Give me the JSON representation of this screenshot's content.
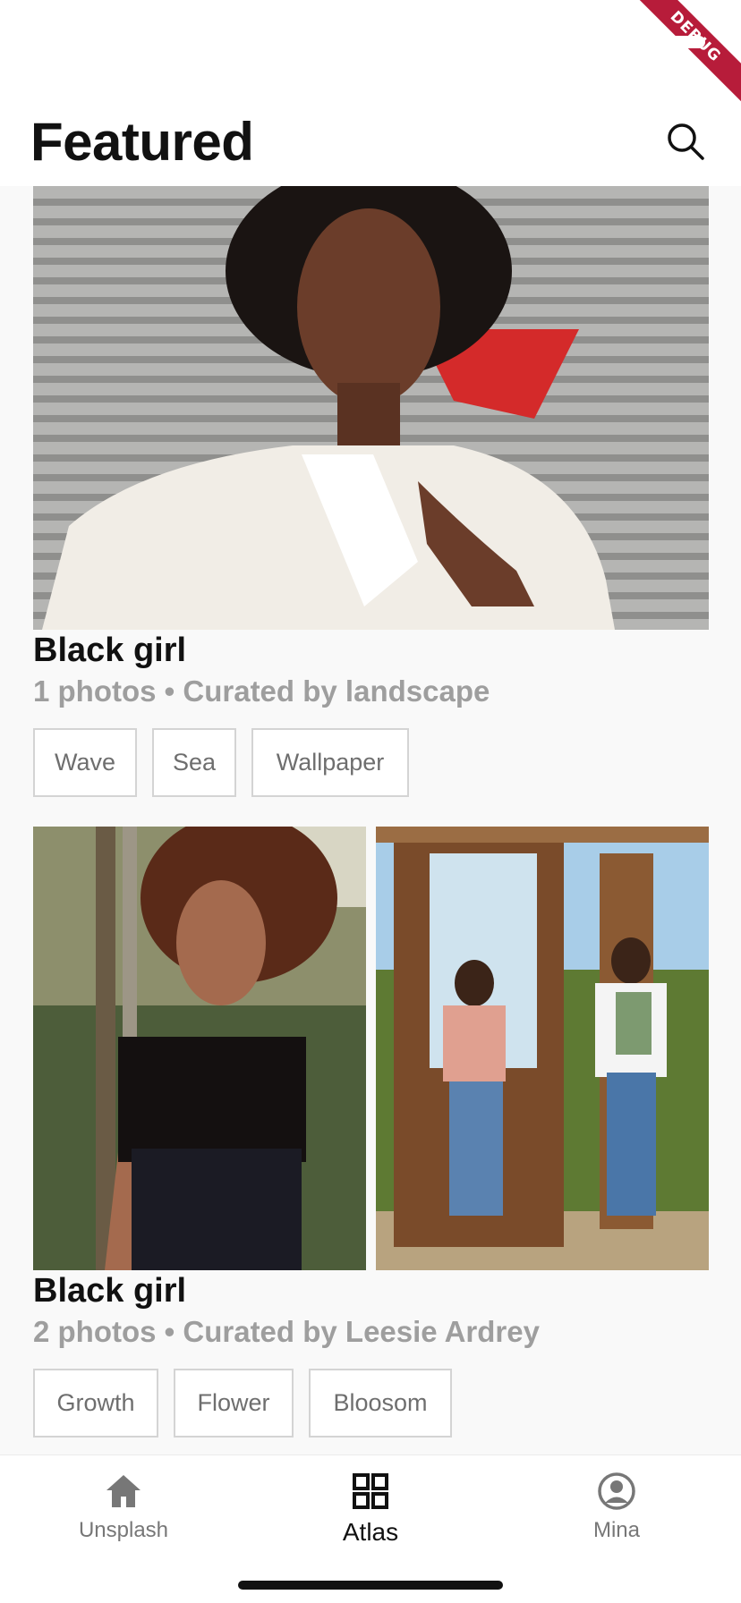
{
  "debug_banner": "DEBUG",
  "header": {
    "title": "Featured",
    "search_icon": "search-icon"
  },
  "collections": [
    {
      "title": "Black girl",
      "subtitle": "1 photos • Curated by landscape",
      "tags": [
        "Wave",
        "Sea",
        "Wallpaper"
      ]
    },
    {
      "title": "Black girl",
      "subtitle": "2 photos • Curated by Leesie Ardrey",
      "tags": [
        "Growth",
        "Flower",
        "Bloosom"
      ]
    }
  ],
  "bottom_nav": {
    "items": [
      {
        "label": "Unsplash",
        "icon": "home-icon",
        "active": false
      },
      {
        "label": "Atlas",
        "icon": "grid-icon",
        "active": true
      },
      {
        "label": "Mina",
        "icon": "account-icon",
        "active": false
      }
    ]
  },
  "colors": {
    "accent": "#111111",
    "muted": "#9e9e9e",
    "tag_border": "#d4d4d4",
    "debug": "#b71c3a"
  }
}
